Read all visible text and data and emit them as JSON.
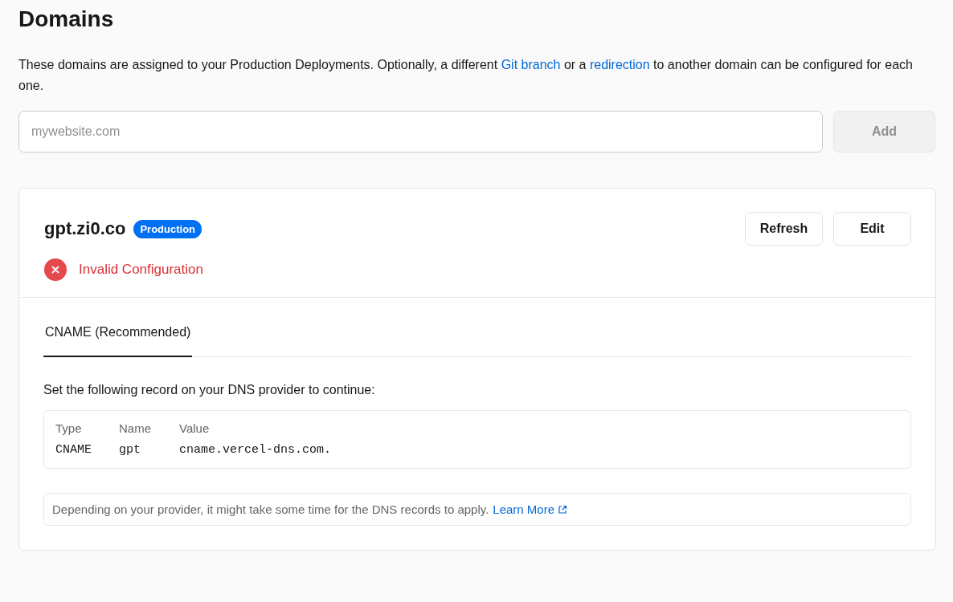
{
  "title": "Domains",
  "intro": [
    {
      "kind": "text",
      "text": "These domains are assigned to your Production Deployments. Optionally, a different "
    },
    {
      "kind": "link",
      "text": "Git branch"
    },
    {
      "kind": "text",
      "text": " or a "
    },
    {
      "kind": "link",
      "text": "redirection"
    },
    {
      "kind": "text",
      "text": " to another domain can be configured for each one."
    }
  ],
  "domain_input": {
    "placeholder": "mywebsite.com"
  },
  "add_button": {
    "label": "Add",
    "disabled": true
  },
  "domain": {
    "name": "gpt.zi0.co",
    "badge": "Production",
    "buttons": [
      "Refresh",
      "Edit"
    ],
    "status": "Invalid Configuration",
    "tabs": [
      {
        "label": "CNAME (Recommended)",
        "selected": true
      }
    ],
    "instruction": "Set the following record on your DNS provider to continue:",
    "record": {
      "columns": [
        "Type",
        "Name",
        "Value"
      ],
      "values": [
        "CNAME",
        "gpt",
        "cname.vercel-dns.com."
      ]
    },
    "note": "Depending on your provider, it might take some time for the DNS records to apply.",
    "note_link": "Learn More"
  }
}
